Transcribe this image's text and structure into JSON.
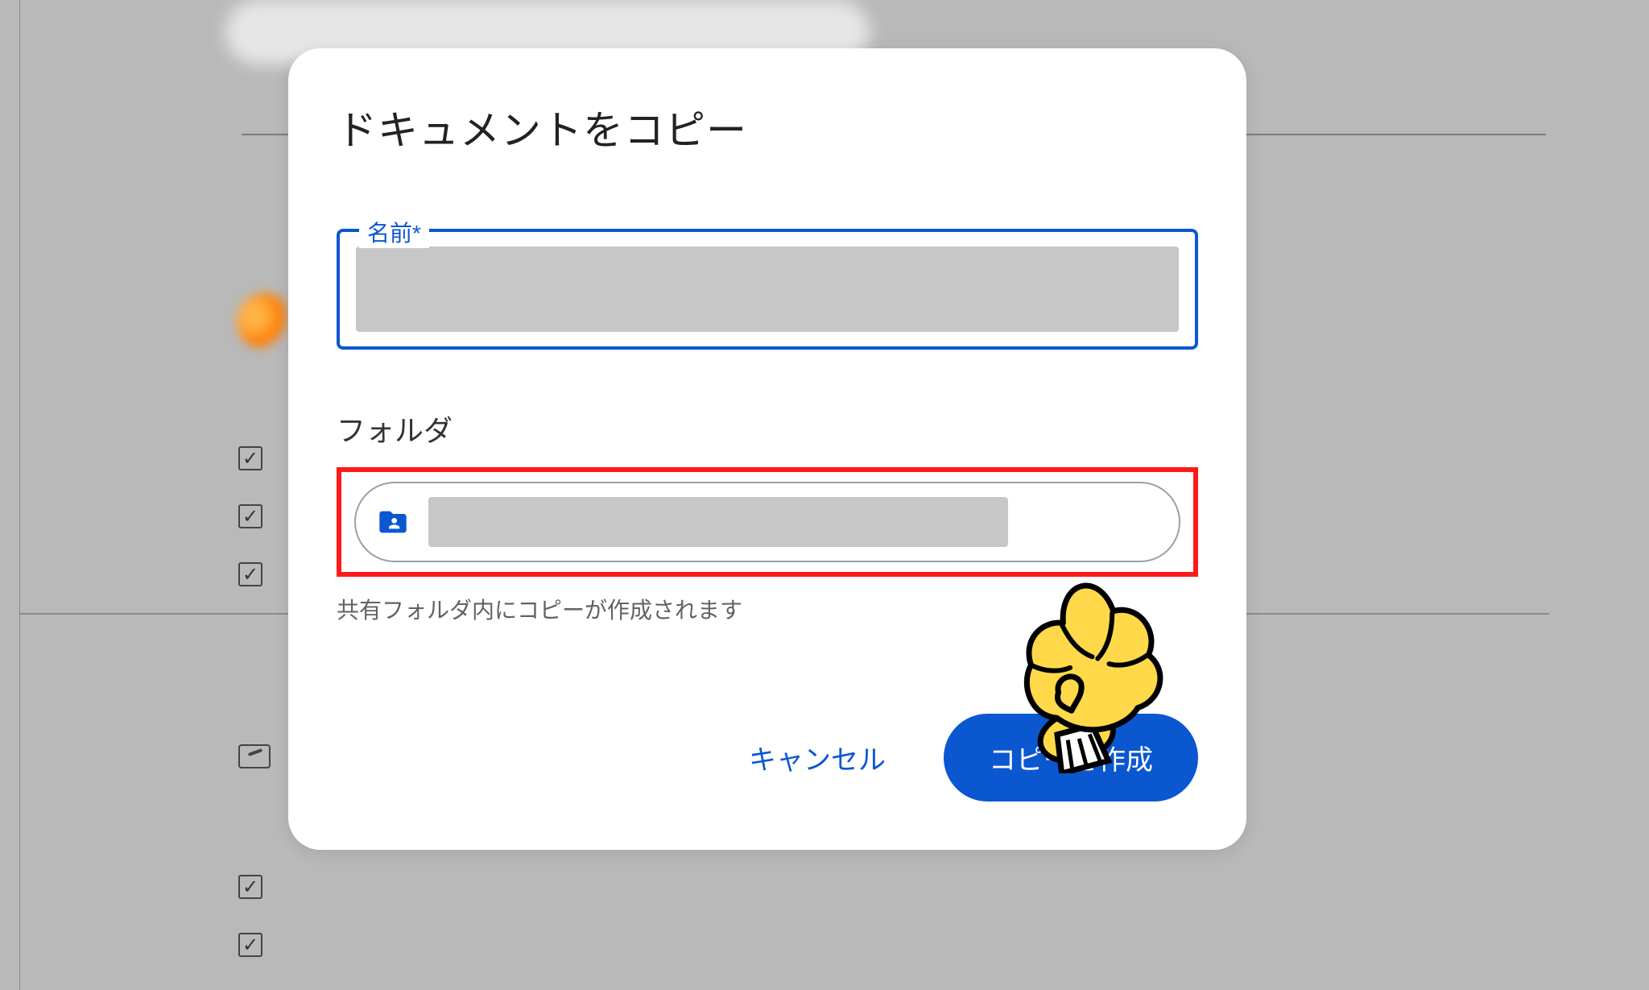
{
  "dialog": {
    "title": "ドキュメントをコピー",
    "name_label": "名前",
    "required_mark": "*",
    "name_value": "",
    "folder_label": "フォルダ",
    "folder_value": "",
    "helper": "共有フォルダ内にコピーが作成されます",
    "cancel": "キャンセル",
    "submit": "コピーを作成"
  },
  "annotation": {
    "highlight": "folder-selector",
    "pointer": "cartoon-hand"
  }
}
